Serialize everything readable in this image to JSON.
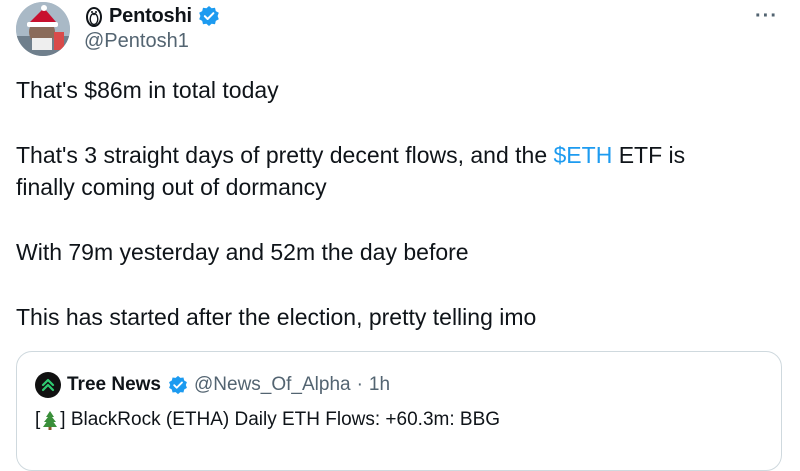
{
  "author": {
    "display_name": "Pentoshi",
    "handle": "@Pentosh1",
    "verified_color": "#1d9bf0",
    "avatar_icon": "avatar-santa-image",
    "name_icon": "penguin-icon"
  },
  "more_label": "···",
  "tweet": {
    "line1": "That's $86m in total today",
    "line2_pre": "That's 3 straight days of pretty decent flows, and the ",
    "line2_cashtag": "$ETH",
    "line2_post": " ETF is",
    "line3": "finally coming out of dormancy",
    "line4": "With 79m yesterday and 52m the day before",
    "line5": "This has started after the election, pretty telling imo"
  },
  "quote": {
    "display_name": "Tree News",
    "handle": "@News_Of_Alpha",
    "separator": "·",
    "time": "1h",
    "text_open": "[",
    "text_close": "] BlackRock (ETHA) Daily ETH Flows: +60.3m: BBG",
    "avatar_icon": "tree-news-logo-icon",
    "inline_icon": "christmas-tree-icon"
  },
  "colors": {
    "link": "#1d9bf0",
    "text": "#0f1419",
    "muted": "#536471",
    "border": "#cfd9de"
  }
}
